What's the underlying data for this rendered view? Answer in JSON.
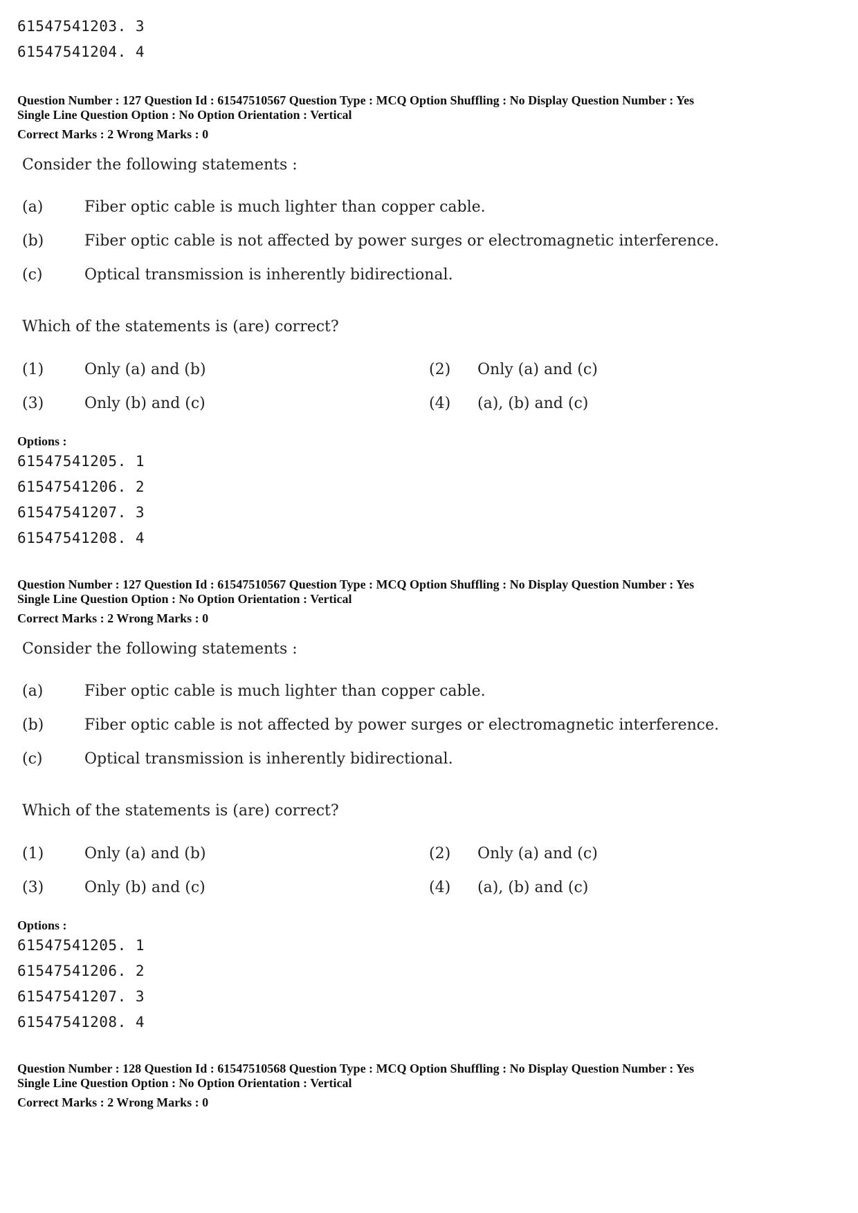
{
  "prev_options": [
    "61547541203. 3",
    "61547541204. 4"
  ],
  "blocks": [
    {
      "meta_line1": "Question Number : 127  Question Id : 61547510567  Question Type : MCQ  Option Shuffling : No  Display Question Number : Yes",
      "meta_line2": "Single Line Question Option : No  Option Orientation : Vertical",
      "marks": "Correct Marks : 2  Wrong Marks : 0",
      "intro": "Consider the following statements :",
      "statements": [
        {
          "label": "(a)",
          "text": "Fiber optic cable is much lighter than copper cable."
        },
        {
          "label": "(b)",
          "text": "Fiber optic cable is not affected by power surges or electromagnetic interference."
        },
        {
          "label": "(c)",
          "text": "Optical transmission is inherently bidirectional."
        }
      ],
      "prompt": "Which of the statements is (are) correct?",
      "choices": [
        {
          "label": "(1)",
          "text": "Only (a) and (b)"
        },
        {
          "label": "(2)",
          "text": "Only (a) and (c)"
        },
        {
          "label": "(3)",
          "text": "Only (b) and (c)"
        },
        {
          "label": "(4)",
          "text": "(a), (b) and (c)"
        }
      ],
      "options_label": "Options :",
      "options": [
        "61547541205. 1",
        "61547541206. 2",
        "61547541207. 3",
        "61547541208. 4"
      ]
    },
    {
      "meta_line1": "Question Number : 127  Question Id : 61547510567  Question Type : MCQ  Option Shuffling : No  Display Question Number : Yes",
      "meta_line2": "Single Line Question Option : No  Option Orientation : Vertical",
      "marks": "Correct Marks : 2  Wrong Marks : 0",
      "intro": "Consider the following statements :",
      "statements": [
        {
          "label": "(a)",
          "text": "Fiber optic cable is much lighter than copper cable."
        },
        {
          "label": "(b)",
          "text": "Fiber optic cable is not affected by power surges or electromagnetic interference."
        },
        {
          "label": "(c)",
          "text": "Optical transmission is inherently bidirectional."
        }
      ],
      "prompt": "Which of the statements is (are) correct?",
      "choices": [
        {
          "label": "(1)",
          "text": "Only (a) and (b)"
        },
        {
          "label": "(2)",
          "text": "Only (a) and (c)"
        },
        {
          "label": "(3)",
          "text": "Only (b) and (c)"
        },
        {
          "label": "(4)",
          "text": "(a), (b) and (c)"
        }
      ],
      "options_label": "Options :",
      "options": [
        "61547541205. 1",
        "61547541206. 2",
        "61547541207. 3",
        "61547541208. 4"
      ]
    }
  ],
  "next_question": {
    "meta_line1": "Question Number : 128  Question Id : 61547510568  Question Type : MCQ  Option Shuffling : No  Display Question Number : Yes",
    "meta_line2": "Single Line Question Option : No  Option Orientation : Vertical",
    "marks": "Correct Marks : 2  Wrong Marks : 0"
  }
}
